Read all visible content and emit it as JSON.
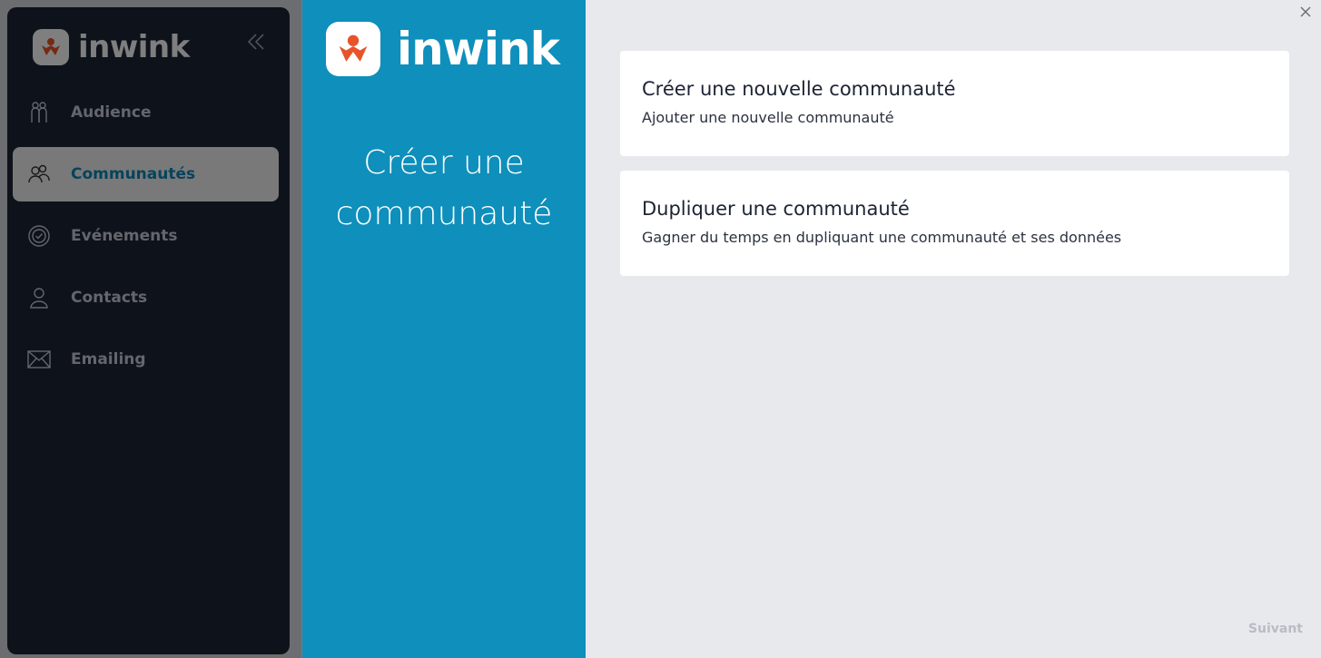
{
  "sidebar": {
    "brand": "inwink",
    "collapse_icon": "chevrons-left-icon",
    "items": [
      {
        "label": "Audience",
        "icon": "audience-icon"
      },
      {
        "label": "Communautés",
        "icon": "community-icon",
        "active": true
      },
      {
        "label": "Evénements",
        "icon": "event-badge-icon"
      },
      {
        "label": "Contacts",
        "icon": "user-icon"
      },
      {
        "label": "Emailing",
        "icon": "envelope-icon"
      }
    ]
  },
  "modal": {
    "brand": "inwink",
    "heading": "Créer une communauté",
    "close_icon": "close-icon",
    "options": [
      {
        "title": "Créer une nouvelle communauté",
        "description": "Ajouter une nouvelle communauté"
      },
      {
        "title": "Dupliquer une communauté",
        "description": "Gagner du temps en dupliquant une communauté et ses données"
      }
    ],
    "next_label": "Suivant"
  },
  "colors": {
    "brand_blue": "#0f8fbb",
    "brand_orange": "#e8542a",
    "sidebar_dark": "#1d2536",
    "modal_bg": "#e8e9ed"
  }
}
